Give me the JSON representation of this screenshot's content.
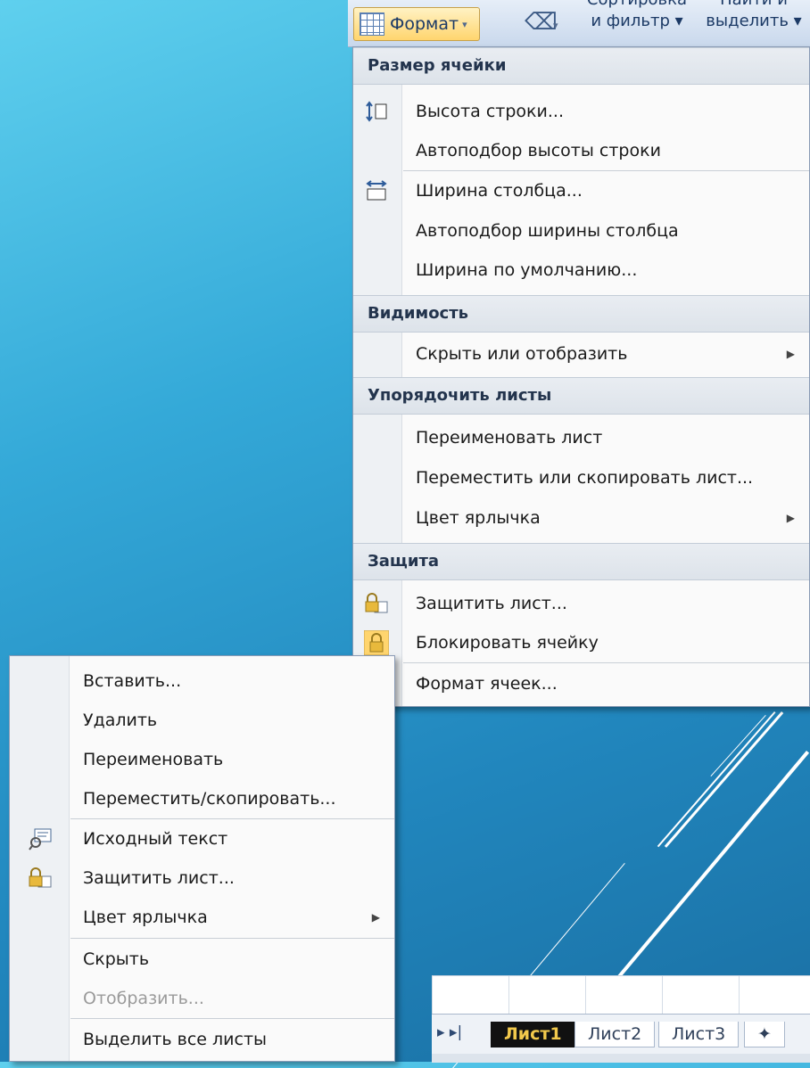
{
  "ribbon": {
    "format_label": "Формат",
    "sort_line1": "Сортировка",
    "sort_line2": "и фильтр ▾",
    "find_line1": "Найти и",
    "find_line2": "выделить ▾"
  },
  "format_menu": {
    "sections": [
      {
        "header": "Размер ячейки"
      },
      {
        "header": "Видимость"
      },
      {
        "header": "Упорядочить листы"
      },
      {
        "header": "Защита"
      }
    ],
    "items": [
      {
        "label": "Высота строки...",
        "icon": "row-height-icon"
      },
      {
        "label": "Автоподбор высоты строки"
      },
      {
        "label": "Ширина столбца...",
        "icon": "column-width-icon"
      },
      {
        "label": "Автоподбор ширины столбца"
      },
      {
        "label": "Ширина по умолчанию..."
      },
      {
        "label": "Скрыть или отобразить",
        "submenu": true
      },
      {
        "label": "Переименовать лист"
      },
      {
        "label": "Переместить или скопировать лист..."
      },
      {
        "label": "Цвет ярлычка",
        "submenu": true
      },
      {
        "label": "Защитить лист...",
        "icon": "protect-sheet-icon"
      },
      {
        "label": "Блокировать ячейку",
        "icon": "lock-icon"
      },
      {
        "label": "Формат ячеек...",
        "icon": "format-cells-icon"
      }
    ]
  },
  "context_menu": {
    "items": [
      {
        "label": "Вставить..."
      },
      {
        "label": "Удалить"
      },
      {
        "label": "Переименовать"
      },
      {
        "label": "Переместить/скопировать..."
      },
      {
        "label": "Исходный текст",
        "icon": "view-code-icon"
      },
      {
        "label": "Защитить лист...",
        "icon": "protect-sheet-icon"
      },
      {
        "label": "Цвет ярлычка",
        "submenu": true
      },
      {
        "label": "Скрыть"
      },
      {
        "label": "Отобразить...",
        "disabled": true
      },
      {
        "label": "Выделить все листы"
      }
    ]
  },
  "sheet_tabs": {
    "tabs": [
      "Лист1",
      "Лист2",
      "Лист3"
    ],
    "active": "Лист1"
  }
}
